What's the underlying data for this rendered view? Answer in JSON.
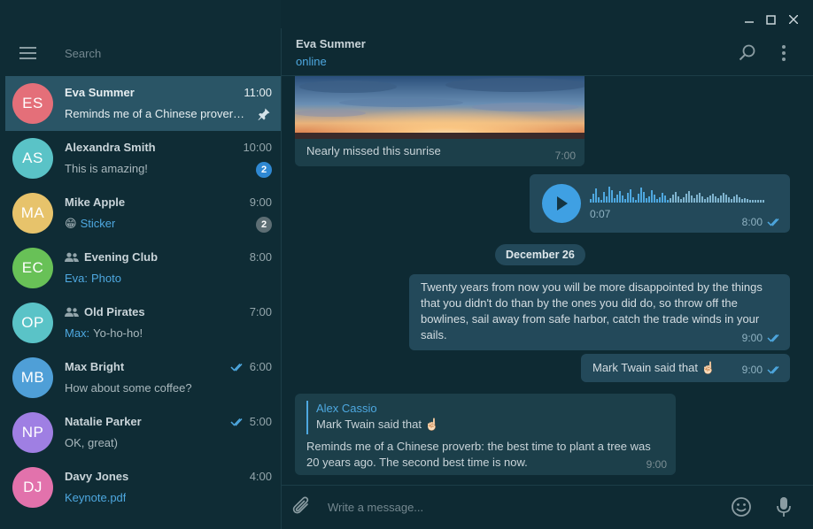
{
  "window": {
    "controls": [
      "minimize-icon",
      "maximize-icon",
      "close-icon"
    ]
  },
  "sidebar": {
    "search_placeholder": "Search",
    "chats": [
      {
        "initials": "ES",
        "name": "Eva Summer",
        "time": "11:00",
        "preview": "Reminds me of a Chinese prover…",
        "preview_prefix": "",
        "avatar_color": "#e46f79",
        "pinned": true,
        "active": true,
        "group": false,
        "read": false,
        "unread": ""
      },
      {
        "initials": "AS",
        "name": "Alexandra Smith",
        "time": "10:00",
        "preview": "This is amazing!",
        "preview_prefix": "",
        "avatar_color": "#5ac3c7",
        "pinned": false,
        "active": false,
        "group": false,
        "read": false,
        "unread": "2",
        "badge_color": "#2f88d2"
      },
      {
        "initials": "MA",
        "name": "Mike Apple",
        "time": "9:00",
        "preview": "Sticker",
        "preview_prefix": "😁",
        "preview_accent": true,
        "avatar_color": "#e7c36b",
        "pinned": false,
        "active": false,
        "group": false,
        "read": false,
        "unread": "2",
        "badge_color": "#5d6e74"
      },
      {
        "initials": "EC",
        "name": "Evening Club",
        "time": "8:00",
        "preview": "Photo",
        "preview_prefix": "Eva:",
        "preview_accent": true,
        "avatar_color": "#68c157",
        "pinned": false,
        "active": false,
        "group": true,
        "read": false,
        "unread": ""
      },
      {
        "initials": "OP",
        "name": "Old Pirates",
        "time": "7:00",
        "preview": "Yo-ho-ho!",
        "preview_prefix": "Max:",
        "avatar_color": "#5ac3c7",
        "pinned": false,
        "active": false,
        "group": true,
        "read": false,
        "unread": ""
      },
      {
        "initials": "MB",
        "name": "Max Bright",
        "time": "6:00",
        "preview": "How about some coffee?",
        "preview_prefix": "",
        "avatar_color": "#4f9fd7",
        "pinned": false,
        "active": false,
        "group": false,
        "read": true,
        "unread": ""
      },
      {
        "initials": "NP",
        "name": "Natalie Parker",
        "time": "5:00",
        "preview": "OK, great)",
        "preview_prefix": "",
        "avatar_color": "#9f7fe3",
        "pinned": false,
        "active": false,
        "group": false,
        "read": true,
        "unread": ""
      },
      {
        "initials": "DJ",
        "name": "Davy Jones",
        "time": "4:00",
        "preview": "Keynote.pdf",
        "preview_prefix": "",
        "preview_accent": true,
        "avatar_color": "#e272ac",
        "pinned": false,
        "active": false,
        "group": false,
        "read": false,
        "unread": ""
      }
    ]
  },
  "chat": {
    "peer_name": "Eva Summer",
    "peer_status": "online",
    "messages": {
      "photo": {
        "caption": "Nearly missed this sunrise",
        "time": "7:00"
      },
      "voice": {
        "duration": "0:07",
        "time": "8:00"
      },
      "date_separator": "December 26",
      "long_quote": {
        "text": "Twenty years from now you will be more disappointed by the things that you didn't do than by the ones you did do, so throw off the bowlines, sail away from safe harbor, catch the trade winds in your sails.",
        "time": "9:00"
      },
      "short": {
        "text": "Mark Twain said that ☝🏻",
        "time": "9:00"
      },
      "reply": {
        "author": "Alex Cassio",
        "quoted": "Mark Twain said that ☝🏻",
        "text": "Reminds me of a Chinese proverb: the best time to plant a tree was 20 years ago. The second best time is now.",
        "time": "9:00"
      }
    }
  },
  "composer": {
    "placeholder": "Write a message..."
  },
  "colors": {
    "accent": "#4ea8e0",
    "outgoing_bubble": "#23495a",
    "incoming_bubble": "#1c3f4a",
    "background": "#0e2a33"
  }
}
